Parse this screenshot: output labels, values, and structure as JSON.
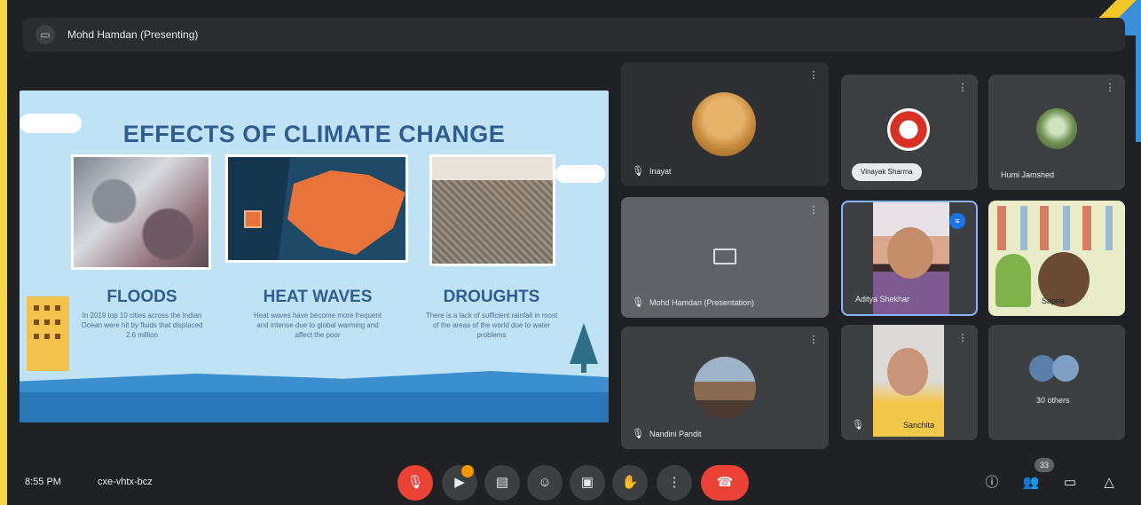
{
  "presenter": {
    "label": "Mohd Hamdan (Presenting)"
  },
  "slide": {
    "title": "EFFECTS OF CLIMATE CHANGE",
    "sections": [
      {
        "heading": "FLOODS",
        "body": "In 2019 top 10 cities across the Indian Ocean were hit by fluids that displaced 2.6 million"
      },
      {
        "heading": "HEAT WAVES",
        "body": "Heat waves have become more frequent and intense due to global warming and affect the poor"
      },
      {
        "heading": "DROUGHTS",
        "body": "There is a lack of sufficient rainfall in most of the areas of the world due to water problems"
      }
    ]
  },
  "participants": [
    {
      "name": "Inayat",
      "icon": "more-vert-icon"
    },
    {
      "name": "Vinayak Sharma",
      "icon": "more-vert-icon"
    },
    {
      "name": "Humi Jamshed",
      "icon": "more-vert-icon"
    },
    {
      "name": "Mohd Hamdan (Presentation)",
      "icon": "more-vert-icon"
    },
    {
      "name": "Aditya Shekhar",
      "icon": "more-vert-icon"
    },
    {
      "name": "Sapna",
      "icon": "more-vert-icon"
    },
    {
      "name": "Nandini Pandit",
      "icon": "more-vert-icon"
    },
    {
      "name": "Sanchita",
      "icon": "more-vert-icon"
    },
    {
      "name": "30 others",
      "icon": "more-vert-icon"
    }
  ],
  "bottombar": {
    "time": "8:55 PM",
    "meeting_code": "cxe-vhtx-bcz",
    "participant_count": "33"
  },
  "colors": {
    "background": "#202124",
    "tile": "#3c4043",
    "hangup": "#ea4335",
    "accent": "#1a73e8",
    "slide_bg": "#bfe3f4",
    "slide_title": "#2f5d8f"
  }
}
